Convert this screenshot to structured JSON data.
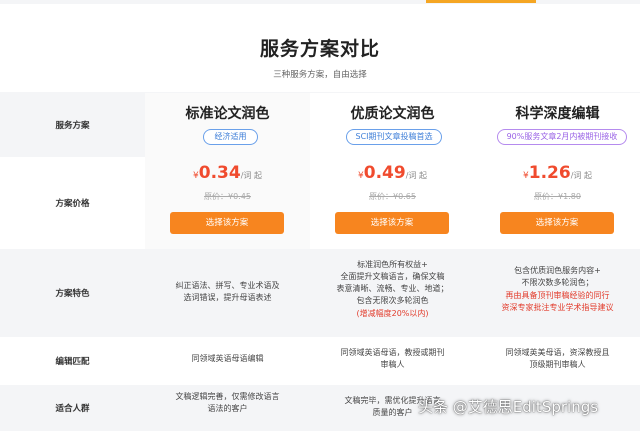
{
  "page": {
    "title": "服务方案对比",
    "subtitle": "三种服务方案，自由选择"
  },
  "rows": {
    "plan_label": "服务方案",
    "price_label": "方案价格",
    "features_label": "方案特色",
    "editor_label": "编辑匹配",
    "audience_label": "适合人群"
  },
  "plans": [
    {
      "name": "标准论文润色",
      "badge": "经济适用",
      "yen": "¥",
      "price": "0.34",
      "unit": "/词 起",
      "orig_price": "原价：¥0.45",
      "button": "选择该方案",
      "features": [
        "纠正语法、拼写、专业术语及",
        "选词错误，提升母语表述"
      ],
      "editor": [
        "同领域英语母语编辑"
      ],
      "audience": [
        "文稿逻辑完善，仅需修改语言",
        "语法的客户"
      ]
    },
    {
      "name": "优质论文润色",
      "badge": "SCI期刊文章投稿首选",
      "yen": "¥",
      "price": "0.49",
      "unit": "/词 起",
      "orig_price": "原价：¥0.65",
      "button": "选择该方案",
      "features": [
        "标准润色所有权益+",
        "全面提升文稿语言，确保文稿",
        "表意清晰、流畅、专业、地道；",
        "包含无限次多轮润色"
      ],
      "features_red": "(增减幅度20%以内)",
      "editor": [
        "同领域英语母语，教授或期刊",
        "审稿人"
      ],
      "audience": [
        "文稿完毕，需优化提升语言",
        "质量的客户"
      ]
    },
    {
      "name": "科学深度编辑",
      "badge": "90%服务文章2月内被期刊接收",
      "yen": "¥",
      "price": "1.26",
      "unit": "/词 起",
      "orig_price": "原价：¥1.80",
      "button": "选择该方案",
      "features": [
        "包含优质润色服务内容+",
        "不限次数多轮润色；"
      ],
      "features_red": [
        "再由具备顶刊审稿经验的同行",
        "资深专家批注专业学术指导建议"
      ],
      "editor": [
        "同领域英美母语，资深教授且",
        "顶级期刊审稿人"
      ],
      "audience": [
        ""
      ]
    }
  ],
  "watermark": "头条 @艾德思EditSprings",
  "colors": {
    "accent_orange": "#f7851f",
    "price_red": "#f04b2e",
    "badge_blue": "#3f7fd8",
    "badge_purple": "#9a63e6",
    "note_red": "#e23b2b"
  }
}
